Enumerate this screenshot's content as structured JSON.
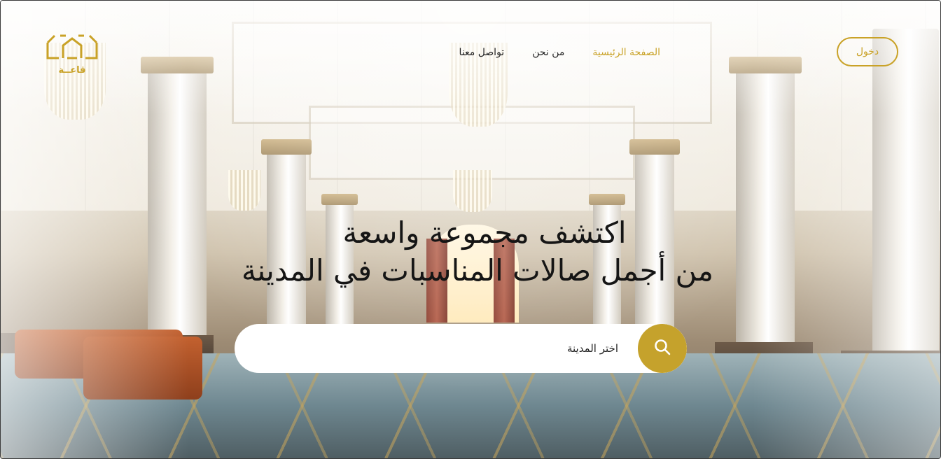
{
  "logo": {
    "text": "قاعــة",
    "icon": "hall-logo-icon"
  },
  "nav": {
    "items": [
      {
        "label": "الصفحة الرئيسية",
        "active": true
      },
      {
        "label": "من نحن",
        "active": false
      },
      {
        "label": "تواصل معنا",
        "active": false
      }
    ]
  },
  "login": {
    "label": "دخول"
  },
  "hero": {
    "line1": "اكتشف مجموعة واسعة",
    "line2": "من أجمل صالات المناسبات في المدينة"
  },
  "search": {
    "placeholder": "اختر المدينة",
    "button_icon": "search-icon"
  },
  "colors": {
    "accent": "#c9a227",
    "text": "#151515"
  }
}
